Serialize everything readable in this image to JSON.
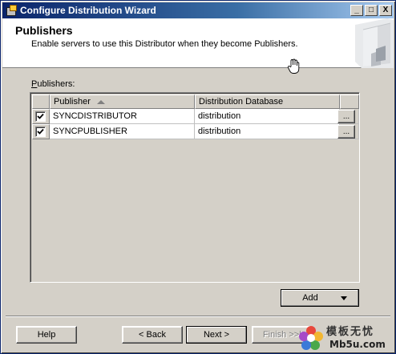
{
  "window": {
    "title": "Configure Distribution Wizard",
    "controls": {
      "minimize": "_",
      "maximize": "□",
      "close": "X"
    }
  },
  "header": {
    "title": "Publishers",
    "subtitle": "Enable servers to use this Distributor when they become Publishers."
  },
  "publishers_label": {
    "accel": "P",
    "rest": "ublishers:"
  },
  "grid": {
    "columns": [
      "Publisher",
      "Distribution Database"
    ],
    "sorted_column": "Publisher",
    "rows": [
      {
        "checked": true,
        "publisher": "SYNCDISTRIBUTOR",
        "database": "distribution",
        "browse": "..."
      },
      {
        "checked": true,
        "publisher": "SYNCPUBLISHER",
        "database": "distribution",
        "browse": "..."
      }
    ]
  },
  "buttons": {
    "add": "Add",
    "help": "Help",
    "back": "< Back",
    "next": "Next >",
    "finish": "Finish >>|"
  },
  "watermark": {
    "line1": "模板无忧",
    "line2": "Mb5u.com"
  },
  "colors": {
    "titlebar_start": "#0a246a",
    "titlebar_end": "#a6caf0",
    "dialog_face": "#d4d0c8"
  },
  "icons": {
    "app": "wizard-icon",
    "header_art": "server-illustration",
    "cursor": "hand-cursor-icon"
  }
}
